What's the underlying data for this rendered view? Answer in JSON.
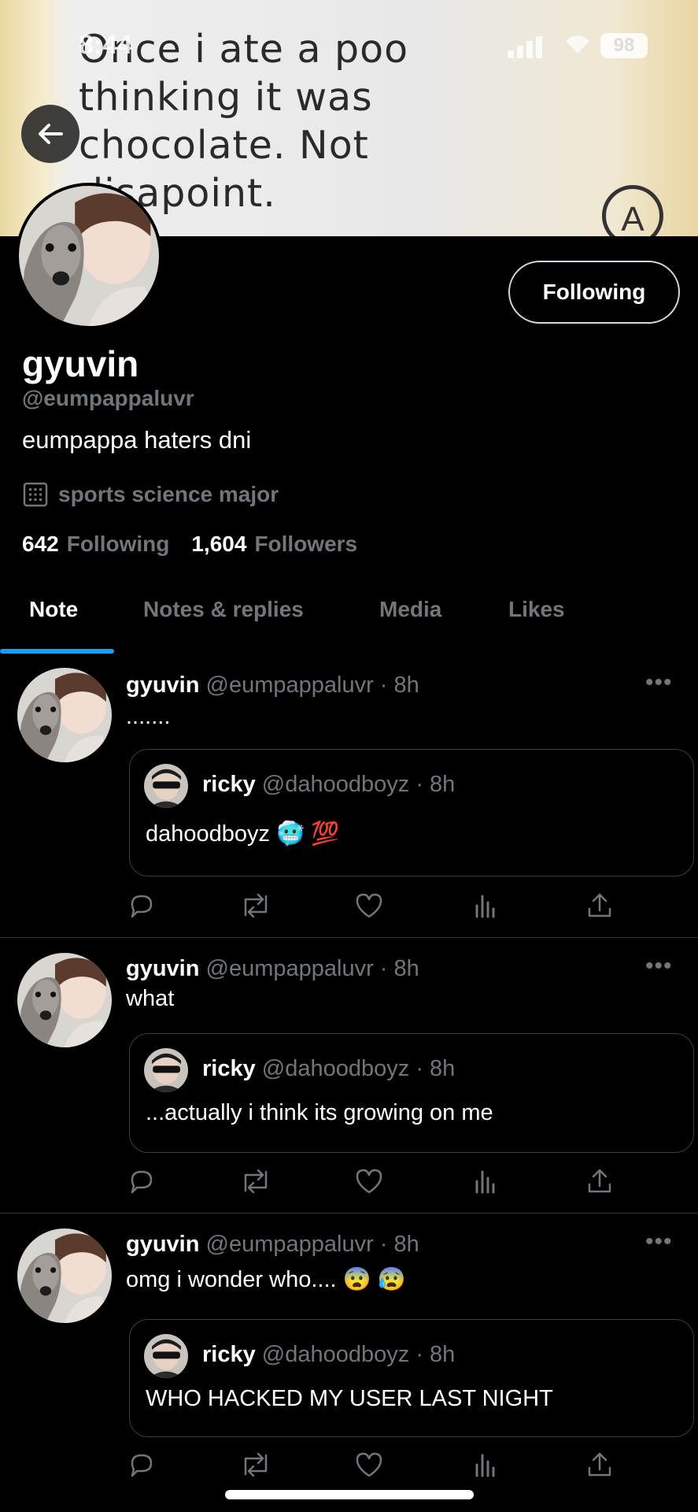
{
  "banner": {
    "note_text": "Once i ate a poo\nthinking it was\nchocolate. Not\ndisapoint.",
    "corner_letter": "A"
  },
  "status_bar": {
    "time": "8:44",
    "battery": "98"
  },
  "profile": {
    "display_name": "gyuvin",
    "handle": "@eumpappaluvr",
    "bio": "eumpappa haters dni",
    "category": "sports science major",
    "following_count": "642",
    "following_label": "Following",
    "followers_count": "1,604",
    "followers_label": "Followers",
    "follow_button": "Following"
  },
  "tabs": [
    "Note",
    "Notes & replies",
    "Media",
    "Likes"
  ],
  "posts": [
    {
      "name": "gyuvin",
      "handle_time": "@eumpappaluvr · 8h",
      "text": ".......",
      "quote": {
        "name": "ricky",
        "handle_time": "@dahoodboyz · 8h",
        "text": "dahoodboyz 🥶 💯"
      }
    },
    {
      "name": "gyuvin",
      "handle_time": "@eumpappaluvr · 8h",
      "text": "what",
      "quote": {
        "name": "ricky",
        "handle_time": "@dahoodboyz · 8h",
        "text": "...actually i think its growing on me"
      }
    },
    {
      "name": "gyuvin",
      "handle_time": "@eumpappaluvr · 8h",
      "text": "omg i wonder who.... 😨 😰",
      "quote": {
        "name": "ricky",
        "handle_time": "@dahoodboyz · 8h",
        "text": "WHO HACKED MY USER LAST NIGHT"
      }
    }
  ],
  "colors": {
    "accent": "#1d9bf0",
    "muted": "#71767b",
    "background": "#000000"
  }
}
